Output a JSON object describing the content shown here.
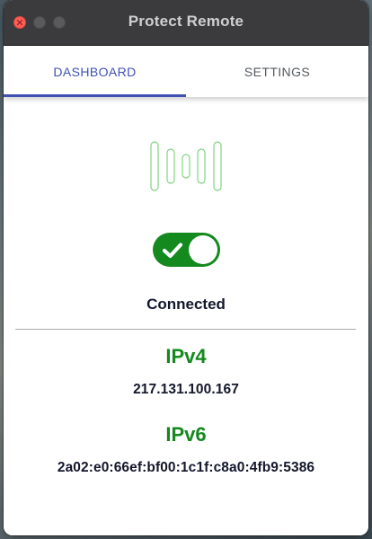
{
  "window": {
    "title": "Protect Remote"
  },
  "tabs": [
    {
      "label": "DASHBOARD",
      "active": true
    },
    {
      "label": "SETTINGS",
      "active": false
    }
  ],
  "dashboard": {
    "logo_icon": "signal-bars-icon",
    "toggle": {
      "state": "on",
      "icon": "check-icon"
    },
    "status": "Connected",
    "ipv4": {
      "label": "IPv4",
      "value": "217.131.100.167"
    },
    "ipv6": {
      "label": "IPv6",
      "value": "2a02:e0:66ef:bf00:1c1f:c8a0:4fb9:5386"
    }
  },
  "colors": {
    "accent": "#3f51b5",
    "success": "#14891e",
    "titlebar": "#3b3b3d"
  }
}
